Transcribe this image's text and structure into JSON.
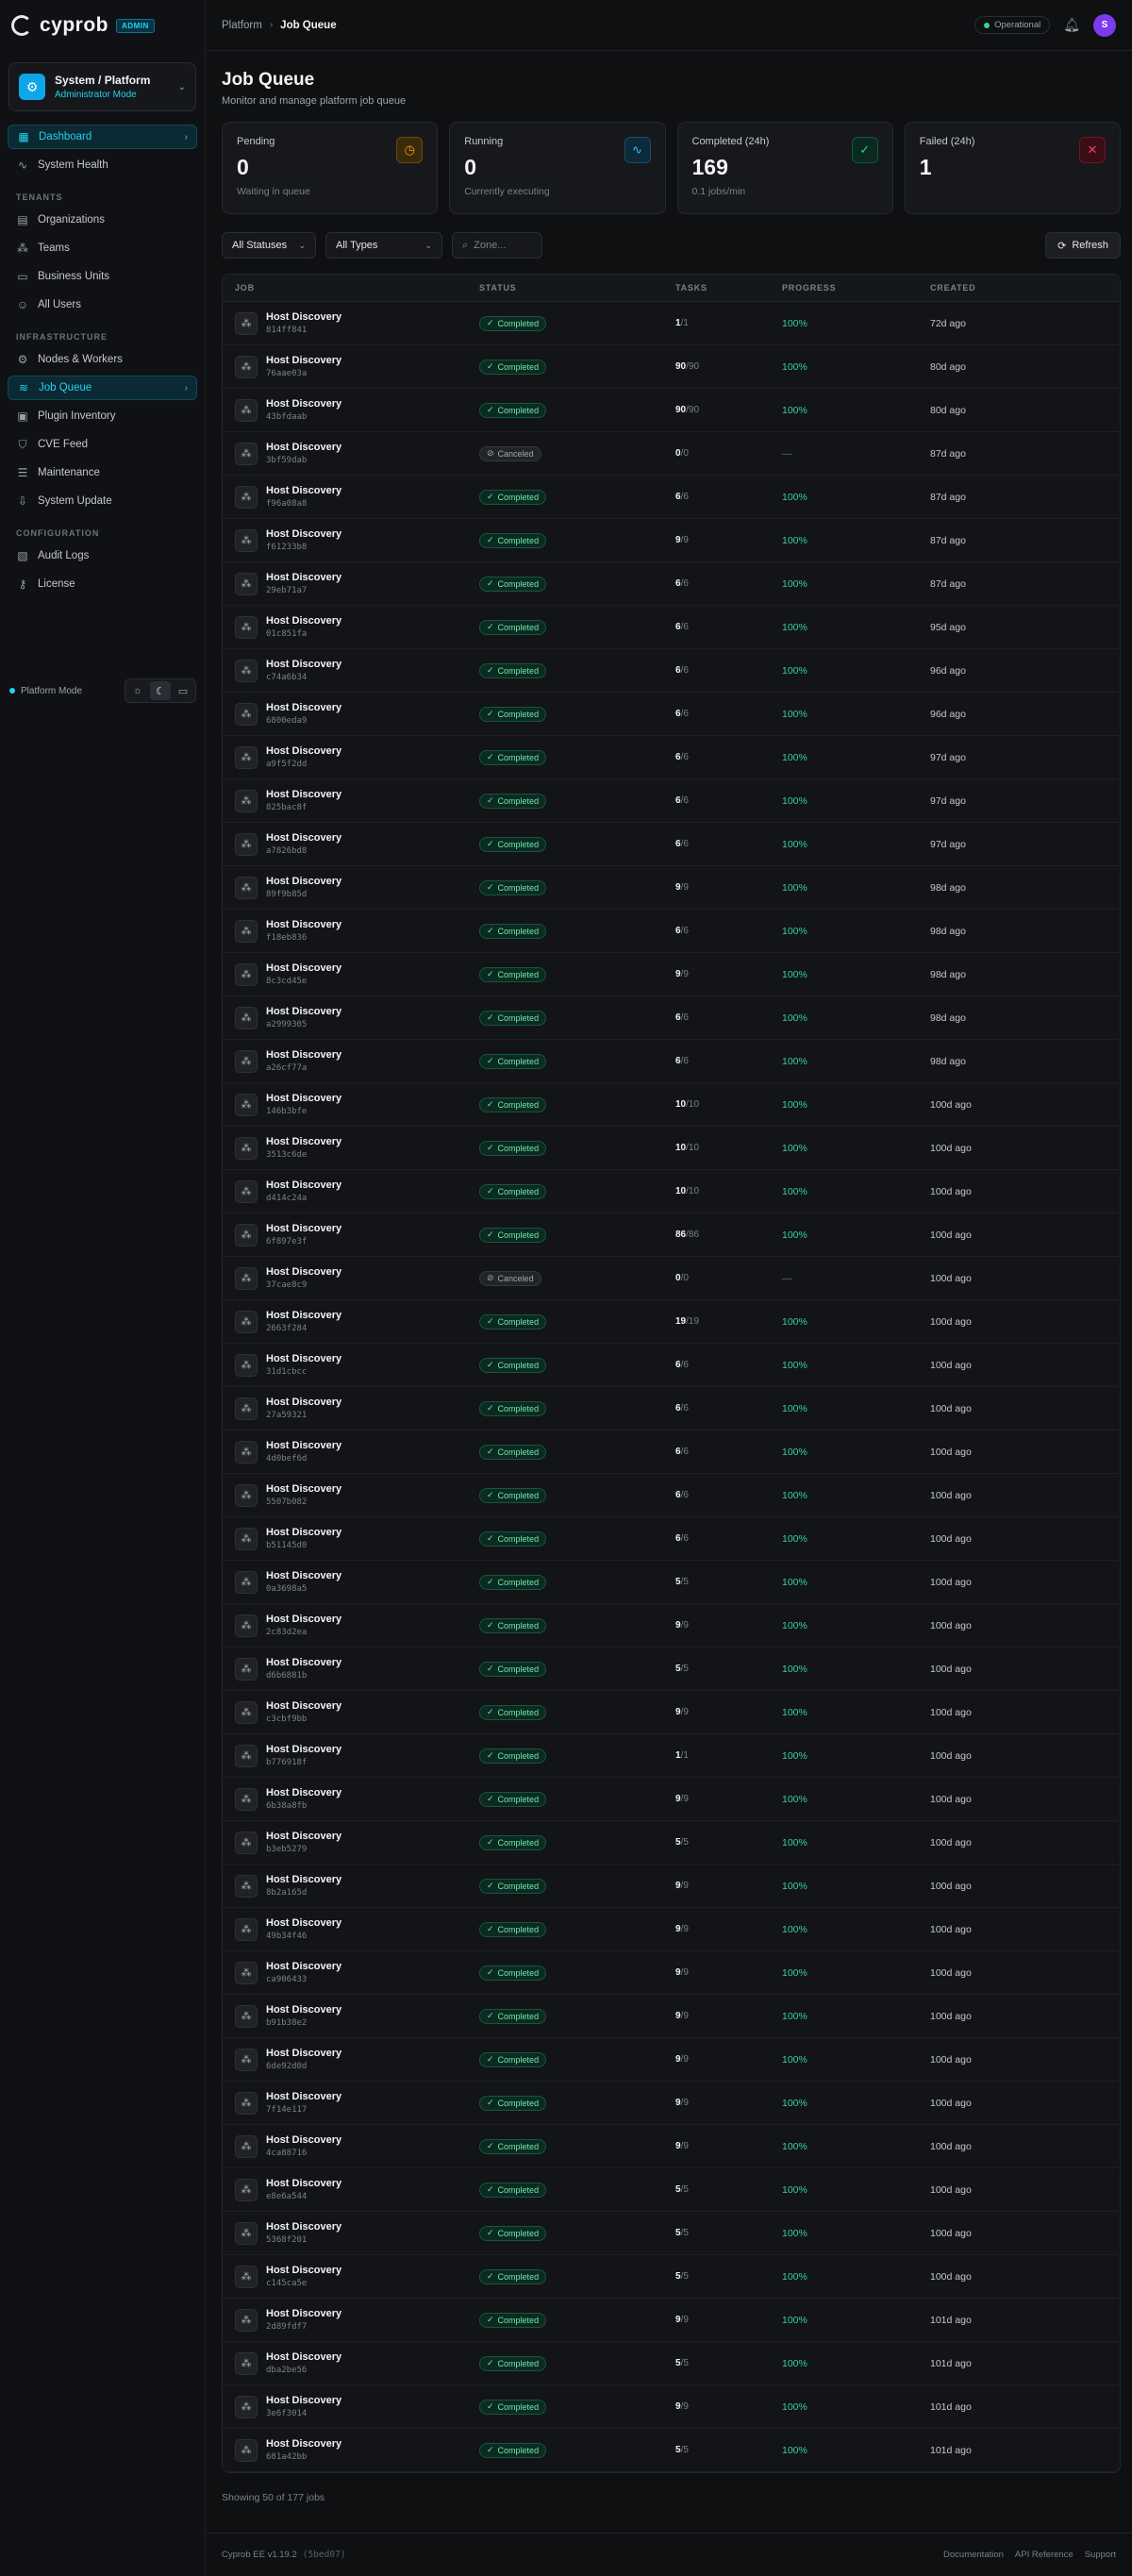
{
  "brand": {
    "name": "cyprob",
    "badge": "ADMIN"
  },
  "context": {
    "title": "System / Platform",
    "subtitle": "Administrator Mode"
  },
  "nav": {
    "top": [
      {
        "label": "Dashboard",
        "icon": "grid-icon",
        "glyph": "▦",
        "active": true
      },
      {
        "label": "System Health",
        "icon": "activity-icon",
        "glyph": "∿"
      }
    ],
    "tenants_label": "TENANTS",
    "tenants": [
      {
        "label": "Organizations",
        "icon": "building-icon",
        "glyph": "▤"
      },
      {
        "label": "Teams",
        "icon": "team-icon",
        "glyph": "⁂"
      },
      {
        "label": "Business Units",
        "icon": "briefcase-icon",
        "glyph": "▭"
      },
      {
        "label": "All Users",
        "icon": "users-icon",
        "glyph": "☺"
      }
    ],
    "infra_label": "INFRASTRUCTURE",
    "infra": [
      {
        "label": "Nodes & Workers",
        "icon": "server-icon",
        "glyph": "⚙"
      },
      {
        "label": "Job Queue",
        "icon": "layers-icon",
        "glyph": "≋",
        "active": true
      },
      {
        "label": "Plugin Inventory",
        "icon": "package-icon",
        "glyph": "▣"
      },
      {
        "label": "CVE Feed",
        "icon": "shield-icon",
        "glyph": "⛉"
      },
      {
        "label": "Maintenance",
        "icon": "database-icon",
        "glyph": "☰"
      },
      {
        "label": "System Update",
        "icon": "download-icon",
        "glyph": "⇩"
      }
    ],
    "config_label": "CONFIGURATION",
    "config": [
      {
        "label": "Audit Logs",
        "icon": "file-text-icon",
        "glyph": "▧"
      },
      {
        "label": "License",
        "icon": "key-icon",
        "glyph": "⚷"
      }
    ]
  },
  "platform_mode": "Platform Mode",
  "breadcrumb": {
    "root": "Platform",
    "current": "Job Queue"
  },
  "status_pill": "Operational",
  "avatar_initial": "S",
  "page": {
    "title": "Job Queue",
    "subtitle": "Monitor and manage platform job queue"
  },
  "stats": [
    {
      "label": "Pending",
      "value": "0",
      "sub": "Waiting in queue",
      "icon": "clock-icon",
      "glyph": "◷",
      "tone": "amber"
    },
    {
      "label": "Running",
      "value": "0",
      "sub": "Currently executing",
      "icon": "activity-icon",
      "glyph": "∿",
      "tone": "blue"
    },
    {
      "label": "Completed (24h)",
      "value": "169",
      "sub": "0.1 jobs/min",
      "icon": "check-circle-icon",
      "glyph": "✓",
      "tone": "green"
    },
    {
      "label": "Failed (24h)",
      "value": "1",
      "sub": "",
      "icon": "x-circle-icon",
      "glyph": "✕",
      "tone": "red"
    }
  ],
  "filters": {
    "status": "All Statuses",
    "type": "All Types",
    "zone_placeholder": "Zone...",
    "refresh": "Refresh"
  },
  "columns": [
    "JOB",
    "STATUS",
    "TASKS",
    "PROGRESS",
    "CREATED"
  ],
  "jobs": [
    {
      "name": "Host Discovery",
      "id": "814ff841",
      "status": "Completed",
      "done": "1",
      "total": "1",
      "progress": "100%",
      "created": "72d ago"
    },
    {
      "name": "Host Discovery",
      "id": "76aae03a",
      "status": "Completed",
      "done": "90",
      "total": "90",
      "progress": "100%",
      "created": "80d ago"
    },
    {
      "name": "Host Discovery",
      "id": "43bfdaab",
      "status": "Completed",
      "done": "90",
      "total": "90",
      "progress": "100%",
      "created": "80d ago"
    },
    {
      "name": "Host Discovery",
      "id": "3bf59dab",
      "status": "Canceled",
      "done": "0",
      "total": "0",
      "progress": "—",
      "created": "87d ago"
    },
    {
      "name": "Host Discovery",
      "id": "f96a08a8",
      "status": "Completed",
      "done": "6",
      "total": "6",
      "progress": "100%",
      "created": "87d ago"
    },
    {
      "name": "Host Discovery",
      "id": "f61233b8",
      "status": "Completed",
      "done": "9",
      "total": "9",
      "progress": "100%",
      "created": "87d ago"
    },
    {
      "name": "Host Discovery",
      "id": "29eb71a7",
      "status": "Completed",
      "done": "6",
      "total": "6",
      "progress": "100%",
      "created": "87d ago"
    },
    {
      "name": "Host Discovery",
      "id": "01c851fa",
      "status": "Completed",
      "done": "6",
      "total": "6",
      "progress": "100%",
      "created": "95d ago"
    },
    {
      "name": "Host Discovery",
      "id": "c74a6b34",
      "status": "Completed",
      "done": "6",
      "total": "6",
      "progress": "100%",
      "created": "96d ago"
    },
    {
      "name": "Host Discovery",
      "id": "6800eda9",
      "status": "Completed",
      "done": "6",
      "total": "6",
      "progress": "100%",
      "created": "96d ago"
    },
    {
      "name": "Host Discovery",
      "id": "a9f5f2dd",
      "status": "Completed",
      "done": "6",
      "total": "6",
      "progress": "100%",
      "created": "97d ago"
    },
    {
      "name": "Host Discovery",
      "id": "825bac8f",
      "status": "Completed",
      "done": "6",
      "total": "6",
      "progress": "100%",
      "created": "97d ago"
    },
    {
      "name": "Host Discovery",
      "id": "a7826bd8",
      "status": "Completed",
      "done": "6",
      "total": "6",
      "progress": "100%",
      "created": "97d ago"
    },
    {
      "name": "Host Discovery",
      "id": "89f9b85d",
      "status": "Completed",
      "done": "9",
      "total": "9",
      "progress": "100%",
      "created": "98d ago"
    },
    {
      "name": "Host Discovery",
      "id": "f18eb836",
      "status": "Completed",
      "done": "6",
      "total": "6",
      "progress": "100%",
      "created": "98d ago"
    },
    {
      "name": "Host Discovery",
      "id": "8c3cd45e",
      "status": "Completed",
      "done": "9",
      "total": "9",
      "progress": "100%",
      "created": "98d ago"
    },
    {
      "name": "Host Discovery",
      "id": "a2999305",
      "status": "Completed",
      "done": "6",
      "total": "6",
      "progress": "100%",
      "created": "98d ago"
    },
    {
      "name": "Host Discovery",
      "id": "a26cf77a",
      "status": "Completed",
      "done": "6",
      "total": "6",
      "progress": "100%",
      "created": "98d ago"
    },
    {
      "name": "Host Discovery",
      "id": "146b3bfe",
      "status": "Completed",
      "done": "10",
      "total": "10",
      "progress": "100%",
      "created": "100d ago"
    },
    {
      "name": "Host Discovery",
      "id": "3513c6de",
      "status": "Completed",
      "done": "10",
      "total": "10",
      "progress": "100%",
      "created": "100d ago"
    },
    {
      "name": "Host Discovery",
      "id": "d414c24a",
      "status": "Completed",
      "done": "10",
      "total": "10",
      "progress": "100%",
      "created": "100d ago"
    },
    {
      "name": "Host Discovery",
      "id": "6f897e3f",
      "status": "Completed",
      "done": "86",
      "total": "86",
      "progress": "100%",
      "created": "100d ago"
    },
    {
      "name": "Host Discovery",
      "id": "37cae8c9",
      "status": "Canceled",
      "done": "0",
      "total": "0",
      "progress": "—",
      "created": "100d ago"
    },
    {
      "name": "Host Discovery",
      "id": "2663f284",
      "status": "Completed",
      "done": "19",
      "total": "19",
      "progress": "100%",
      "created": "100d ago"
    },
    {
      "name": "Host Discovery",
      "id": "31d1cbcc",
      "status": "Completed",
      "done": "6",
      "total": "6",
      "progress": "100%",
      "created": "100d ago"
    },
    {
      "name": "Host Discovery",
      "id": "27a59321",
      "status": "Completed",
      "done": "6",
      "total": "6",
      "progress": "100%",
      "created": "100d ago"
    },
    {
      "name": "Host Discovery",
      "id": "4d0bef6d",
      "status": "Completed",
      "done": "6",
      "total": "6",
      "progress": "100%",
      "created": "100d ago"
    },
    {
      "name": "Host Discovery",
      "id": "5507b082",
      "status": "Completed",
      "done": "6",
      "total": "6",
      "progress": "100%",
      "created": "100d ago"
    },
    {
      "name": "Host Discovery",
      "id": "b51145d0",
      "status": "Completed",
      "done": "6",
      "total": "6",
      "progress": "100%",
      "created": "100d ago"
    },
    {
      "name": "Host Discovery",
      "id": "0a3698a5",
      "status": "Completed",
      "done": "5",
      "total": "5",
      "progress": "100%",
      "created": "100d ago"
    },
    {
      "name": "Host Discovery",
      "id": "2c83d2ea",
      "status": "Completed",
      "done": "9",
      "total": "9",
      "progress": "100%",
      "created": "100d ago"
    },
    {
      "name": "Host Discovery",
      "id": "d6b6881b",
      "status": "Completed",
      "done": "5",
      "total": "5",
      "progress": "100%",
      "created": "100d ago"
    },
    {
      "name": "Host Discovery",
      "id": "c3cbf9bb",
      "status": "Completed",
      "done": "9",
      "total": "9",
      "progress": "100%",
      "created": "100d ago"
    },
    {
      "name": "Host Discovery",
      "id": "b776918f",
      "status": "Completed",
      "done": "1",
      "total": "1",
      "progress": "100%",
      "created": "100d ago"
    },
    {
      "name": "Host Discovery",
      "id": "6b38a8fb",
      "status": "Completed",
      "done": "9",
      "total": "9",
      "progress": "100%",
      "created": "100d ago"
    },
    {
      "name": "Host Discovery",
      "id": "b3eb5279",
      "status": "Completed",
      "done": "5",
      "total": "5",
      "progress": "100%",
      "created": "100d ago"
    },
    {
      "name": "Host Discovery",
      "id": "8b2a165d",
      "status": "Completed",
      "done": "9",
      "total": "9",
      "progress": "100%",
      "created": "100d ago"
    },
    {
      "name": "Host Discovery",
      "id": "49b34f46",
      "status": "Completed",
      "done": "9",
      "total": "9",
      "progress": "100%",
      "created": "100d ago"
    },
    {
      "name": "Host Discovery",
      "id": "ca906433",
      "status": "Completed",
      "done": "9",
      "total": "9",
      "progress": "100%",
      "created": "100d ago"
    },
    {
      "name": "Host Discovery",
      "id": "b91b38e2",
      "status": "Completed",
      "done": "9",
      "total": "9",
      "progress": "100%",
      "created": "100d ago"
    },
    {
      "name": "Host Discovery",
      "id": "6de92d0d",
      "status": "Completed",
      "done": "9",
      "total": "9",
      "progress": "100%",
      "created": "100d ago"
    },
    {
      "name": "Host Discovery",
      "id": "7f14e117",
      "status": "Completed",
      "done": "9",
      "total": "9",
      "progress": "100%",
      "created": "100d ago"
    },
    {
      "name": "Host Discovery",
      "id": "4ca88716",
      "status": "Completed",
      "done": "9",
      "total": "9",
      "progress": "100%",
      "created": "100d ago"
    },
    {
      "name": "Host Discovery",
      "id": "e8e6a544",
      "status": "Completed",
      "done": "5",
      "total": "5",
      "progress": "100%",
      "created": "100d ago"
    },
    {
      "name": "Host Discovery",
      "id": "5368f201",
      "status": "Completed",
      "done": "5",
      "total": "5",
      "progress": "100%",
      "created": "100d ago"
    },
    {
      "name": "Host Discovery",
      "id": "c145ca5e",
      "status": "Completed",
      "done": "5",
      "total": "5",
      "progress": "100%",
      "created": "100d ago"
    },
    {
      "name": "Host Discovery",
      "id": "2d89fdf7",
      "status": "Completed",
      "done": "9",
      "total": "9",
      "progress": "100%",
      "created": "101d ago"
    },
    {
      "name": "Host Discovery",
      "id": "dba2be56",
      "status": "Completed",
      "done": "5",
      "total": "5",
      "progress": "100%",
      "created": "101d ago"
    },
    {
      "name": "Host Discovery",
      "id": "3e6f3014",
      "status": "Completed",
      "done": "9",
      "total": "9",
      "progress": "100%",
      "created": "101d ago"
    },
    {
      "name": "Host Discovery",
      "id": "681a42bb",
      "status": "Completed",
      "done": "5",
      "total": "5",
      "progress": "100%",
      "created": "101d ago"
    }
  ],
  "showing_text": "Showing 50 of 177 jobs",
  "footer": {
    "version": "Cyprob EE v1.19.2",
    "hash": "(5bed07)",
    "links": [
      "Documentation",
      "API Reference",
      "Support"
    ]
  },
  "colors": {
    "accent": "#22d3ee",
    "success": "#34d399",
    "avatar": "#7c3aed",
    "danger": "#f43f5e",
    "warning": "#f59e0b"
  }
}
